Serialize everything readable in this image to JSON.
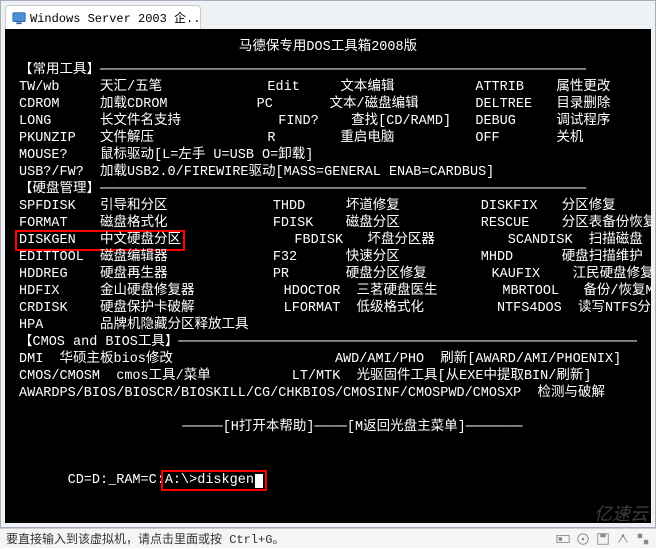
{
  "tab": {
    "title": "Windows Server 2003 企..."
  },
  "console": {
    "title": "马德保专用DOS工具箱2008版",
    "sections": [
      {
        "header": "常用工具",
        "rows": [
          {
            "c1": "TW/wb",
            "c1d": "天汇/五笔",
            "c2": "Edit",
            "c2d": "文本编辑",
            "c3": "ATTRIB",
            "c3d": "属性更改"
          },
          {
            "c1": "CDROM",
            "c1d": "加载CDROM",
            "c2": "PC",
            "c2d": "文本/磁盘编辑",
            "c3": "DELTREE",
            "c3d": "目录删除"
          },
          {
            "c1": "LONG",
            "c1d": "长文件名支持",
            "c2": "FIND?",
            "c2d": "查找[CD/RAMD]",
            "c3": "DEBUG",
            "c3d": "调试程序"
          },
          {
            "c1": "PKUNZIP",
            "c1d": "文件解压",
            "c2": "R",
            "c2d": "重启电脑",
            "c3": "OFF",
            "c3d": "关机"
          },
          {
            "full": "MOUSE?    鼠标驱动[L=左手 U=USB O=卸载]"
          },
          {
            "full": "USB?/FW?  加载USB2.0/FIREWIRE驱动[MASS=GENERAL ENAB=CARDBUS]"
          }
        ]
      },
      {
        "header": "硬盘管理",
        "rows": [
          {
            "c1": "SPFDISK",
            "c1d": "引导和分区",
            "c2": "THDD",
            "c2d": "坏道修复",
            "c3": "DISKFIX",
            "c3d": "分区修复"
          },
          {
            "c1": "FORMAT",
            "c1d": "磁盘格式化",
            "c2": "FDISK",
            "c2d": "磁盘分区",
            "c3": "RESCUE",
            "c3d": "分区表备份恢复"
          },
          {
            "c1": "DISKGEN",
            "c1d": "中文硬盘分区",
            "c2": "FBDISK",
            "c2d": "坏盘分区器",
            "c3": "SCANDISK",
            "c3d": "扫描磁盘",
            "highlight": true
          },
          {
            "c1": "EDITTOOL",
            "c1d": "磁盘编辑器",
            "c2": "F32",
            "c2d": "快速分区",
            "c3": "MHDD",
            "c3d": "硬盘扫描维护"
          },
          {
            "c1": "HDDREG",
            "c1d": "硬盘再生器",
            "c2": "PR",
            "c2d": "硬盘分区修复",
            "c3": "KAUFIX",
            "c3d": "江民硬盘修复"
          },
          {
            "c1": "HDFIX",
            "c1d": "金山硬盘修复器",
            "c2": "HDOCTOR",
            "c2d": "三茗硬盘医生",
            "c3": "MBRTOOL",
            "c3d": "备份/恢复MBR"
          },
          {
            "c1": "CRDISK",
            "c1d": "硬盘保护卡破解",
            "c2": "LFORMAT",
            "c2d": "低级格式化",
            "c3": "NTFS4DOS",
            "c3d": "读写NTFS分区"
          },
          {
            "full": "HPA       品牌机隐藏分区释放工具"
          }
        ]
      },
      {
        "header": "CMOS and BIOS工具",
        "rows": [
          {
            "full": "DMI  华硕主板bios修改                    AWD/AMI/PHO  刷新[AWARD/AMI/PHOENIX]"
          },
          {
            "full": "CMOS/CMOSM  cmos工具/菜单          LT/MTK  光驱固件工具[从EXE中提取BIN/刷新]"
          },
          {
            "full": "AWARDPS/BIOS/BIOSCR/BIOSKILL/CG/CHKBIOS/CMOSINF/CMOSPWD/CMOSXP  检测与破解"
          }
        ]
      }
    ],
    "bottom_hint_left": "[H打开本帮助]",
    "bottom_hint_right": "[M返回光盘主菜单]",
    "prompt_prefix": "CD=D:_RAM=C:",
    "prompt_input": "A:\\>diskgen"
  },
  "statusbar": {
    "text": "要直接输入到该虚拟机，请点击里面或按 Ctrl+G。"
  },
  "watermark": "亿速云"
}
